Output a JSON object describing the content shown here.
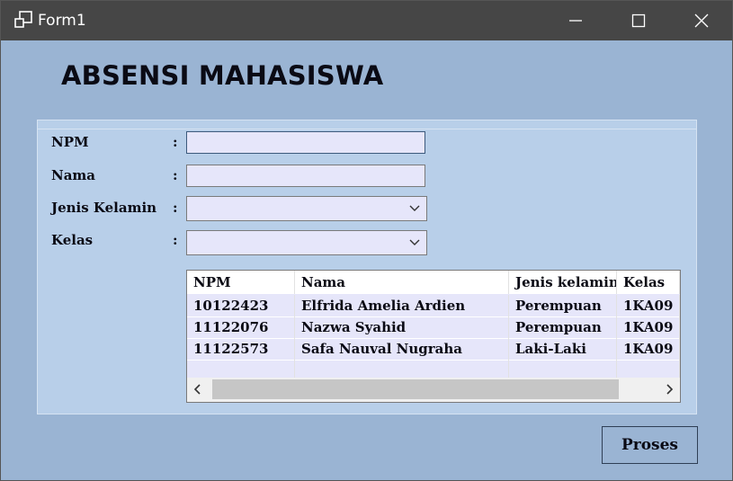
{
  "window": {
    "title": "Form1",
    "icon": "window-restore-icon"
  },
  "heading": "ABSENSI MAHASISWA",
  "form": {
    "npm_label": "NPM",
    "nama_label": "Nama",
    "jenis_kelamin_label": "Jenis Kelamin",
    "kelas_label": "Kelas",
    "colon": ":",
    "npm_value": "",
    "nama_value": "",
    "jenis_kelamin_value": "",
    "kelas_value": ""
  },
  "table": {
    "columns": [
      "NPM",
      "Nama",
      "Jenis kelamin",
      "Kelas"
    ],
    "rows": [
      [
        "10122423",
        "Elfrida Amelia Ardien",
        "Perempuan",
        "1KA09"
      ],
      [
        "11122076",
        "Nazwa Syahid",
        "Perempuan",
        "1KA09"
      ],
      [
        "11122573",
        "Safa Nauval Nugraha",
        "Laki-Laki",
        "1KA09"
      ]
    ]
  },
  "button": {
    "proses_label": "Proses"
  },
  "colors": {
    "background": "#9ab4d3",
    "panel": "#b8cfe9",
    "input": "#e6e6fa",
    "titlebar": "#464646"
  }
}
